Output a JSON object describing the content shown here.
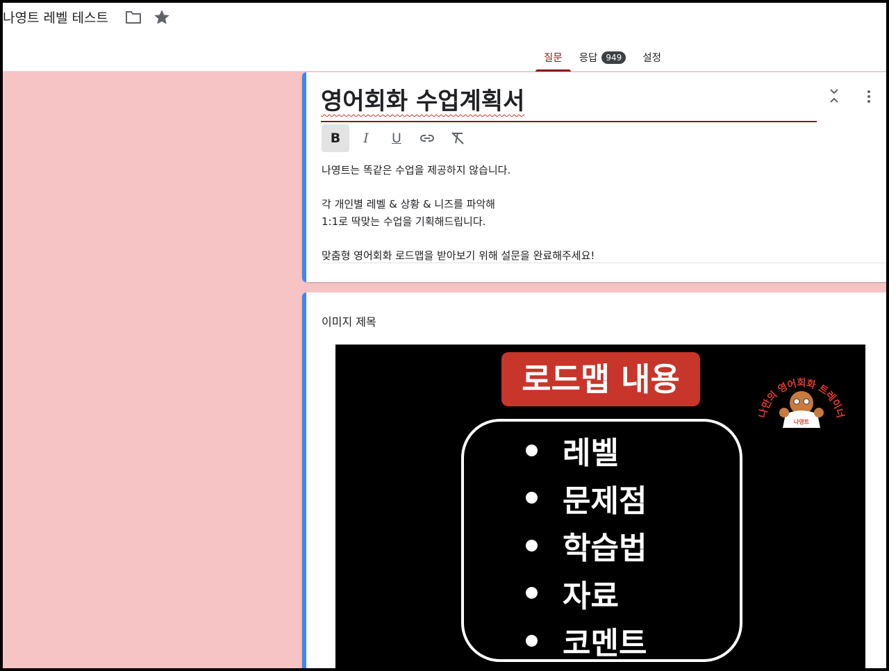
{
  "app": {
    "doc_title": "나영트 레벨 테스트",
    "folder_icon": "folder-icon",
    "star_icon": "star-icon"
  },
  "tabs": [
    {
      "label": "질문",
      "active": true
    },
    {
      "label": "응답",
      "badge": "949",
      "active": false
    },
    {
      "label": "설정",
      "active": false
    }
  ],
  "form": {
    "title": "영어회화 수업계획서",
    "toolbar": {
      "bold": "B",
      "italic": "I",
      "underline": "U"
    },
    "description": "나영트는 똑같은 수업을 제공하지 않습니다.\n\n각 개인별 레벨 & 상황 & 니즈를 파악해\n1:1로 딱맞는 수업을 기획해드립니다.\n\n맞춤형 영어회화 로드맵을 받아보기 위해 설문을 완료해주세요!"
  },
  "image_item": {
    "title": "이미지 제목",
    "roadmap": {
      "heading": "로드맵 내용",
      "items": [
        "레벨",
        "문제점",
        "학습법",
        "자료",
        "코멘트"
      ],
      "logo_text": "나만의 영어회화 트레이너",
      "logo_badge": "나영트"
    }
  },
  "colors": {
    "accent": "#4285f4",
    "brand": "#8b1a1a",
    "background": "#f6c4c4",
    "heading_red": "#c8352b"
  }
}
